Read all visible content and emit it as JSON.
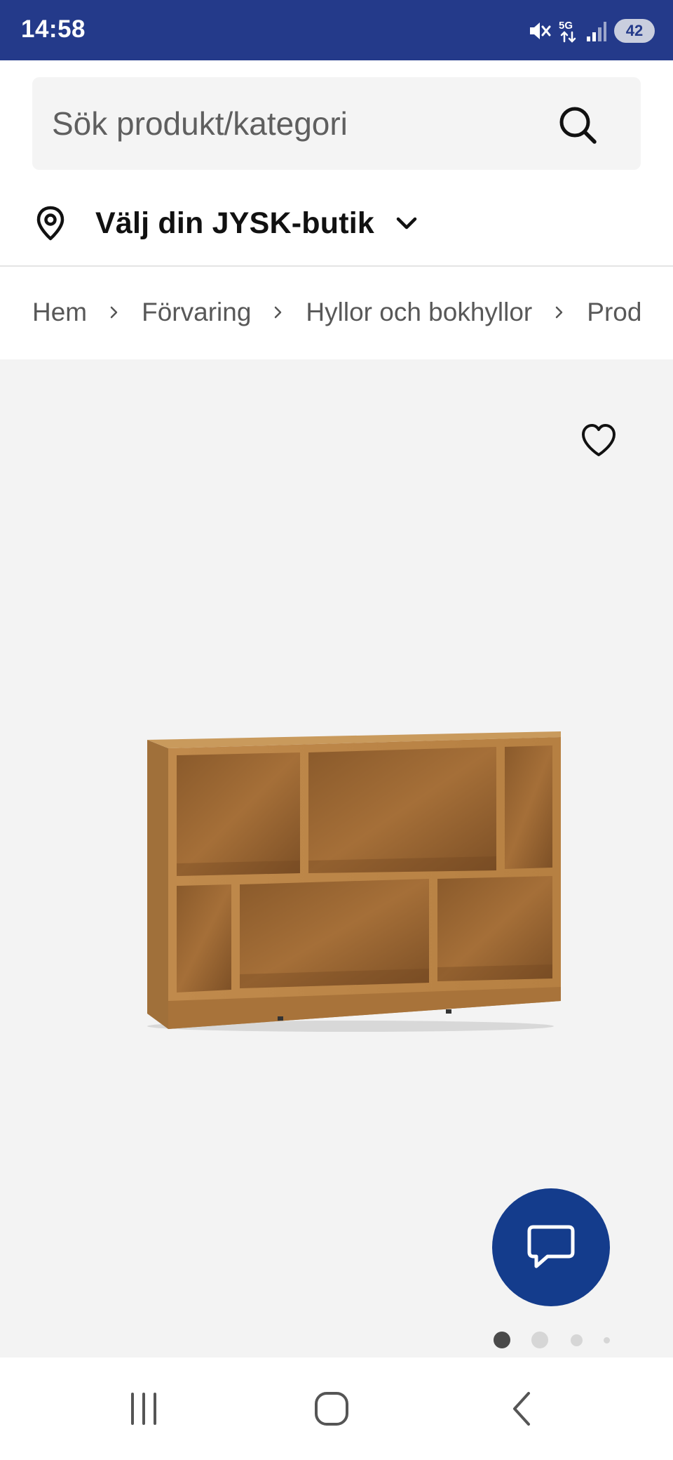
{
  "status_bar": {
    "time": "14:58",
    "network": "5G",
    "battery": "42",
    "icons": [
      "mute-icon",
      "network-5g-icon",
      "signal-icon"
    ]
  },
  "search": {
    "placeholder": "Sök produkt/kategori",
    "value": ""
  },
  "store": {
    "label": "Välj din JYSK-butik"
  },
  "breadcrumb": {
    "items": [
      "Hem",
      "Förvaring",
      "Hyllor och bokhyllor",
      "Produ"
    ]
  },
  "carousel": {
    "total": 4,
    "active": 0
  },
  "colors": {
    "status_bar": "#243a8a",
    "chat_button": "#143c8c",
    "product_bg": "#f3f3f3",
    "wood": "#b07a3c"
  }
}
